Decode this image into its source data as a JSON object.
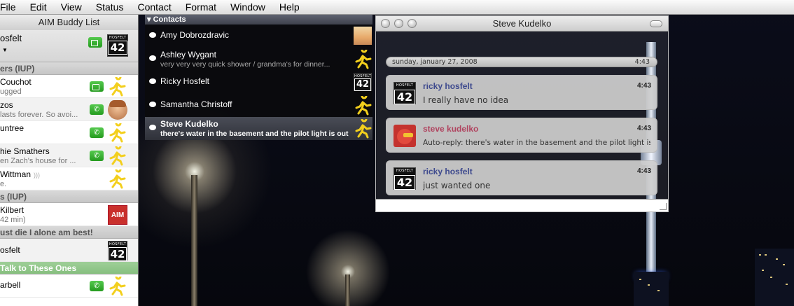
{
  "menubar": {
    "items": [
      "File",
      "Edit",
      "View",
      "Status",
      "Contact",
      "Format",
      "Window",
      "Help"
    ]
  },
  "buddy_list": {
    "title": "AIM Buddy List",
    "profile_name": "osfelt",
    "badge_top": "HOSFELT",
    "badge_num": "42",
    "groups": [
      {
        "label": "ers (IUP)"
      },
      {
        "label": "s (IUP)"
      },
      {
        "label": "ust die I alone am best!"
      },
      {
        "label": "Talk to These Ones"
      }
    ],
    "buddies": [
      {
        "name": "Couchot",
        "status": "ugged"
      },
      {
        "name": "zos",
        "status": "lasts forever. So avoi..."
      },
      {
        "name": "untree",
        "status": ""
      },
      {
        "name": "hie Smathers",
        "status": "en Zach's house for ..."
      },
      {
        "name": "Wittman",
        "status": "e."
      },
      {
        "name": "Kilbert",
        "status": "42 min)"
      },
      {
        "name": "osfelt",
        "status": ""
      },
      {
        "name": "arbell",
        "status": ""
      }
    ],
    "aim_logo": "AIM"
  },
  "contacts": {
    "header": "Contacts",
    "items": [
      {
        "name": "Amy Dobrozdravic",
        "status": ""
      },
      {
        "name": "Ashley Wygant",
        "status": "very very very quick shower / grandma's for dinner..."
      },
      {
        "name": "Ricky Hosfelt",
        "status": ""
      },
      {
        "name": "Samantha Christoff",
        "status": ""
      },
      {
        "name": "Steve Kudelko",
        "status": "there's water in the basement and the pilot light is out"
      }
    ]
  },
  "chat": {
    "title": "Steve Kudelko",
    "date": "sunday, january 27, 2008",
    "date_time": "4:43",
    "messages": [
      {
        "sender": "ricky hosfelt",
        "time": "4:43",
        "text": "I really have no idea"
      },
      {
        "sender": "steve kudelko",
        "time": "4:43",
        "text": "Auto-reply: there's water in the basement and the pilot light is out"
      },
      {
        "sender": "ricky hosfelt",
        "time": "4:43",
        "text": "just wanted one"
      }
    ]
  },
  "colors": {
    "ricky": "#3e4a8e",
    "steve": "#b0435f",
    "green_service": "#2fae28"
  },
  "icons": [
    "camera-icon",
    "phone-icon",
    "aim-running-man-icon",
    "rss-icon",
    "speech-bubble-icon"
  ]
}
